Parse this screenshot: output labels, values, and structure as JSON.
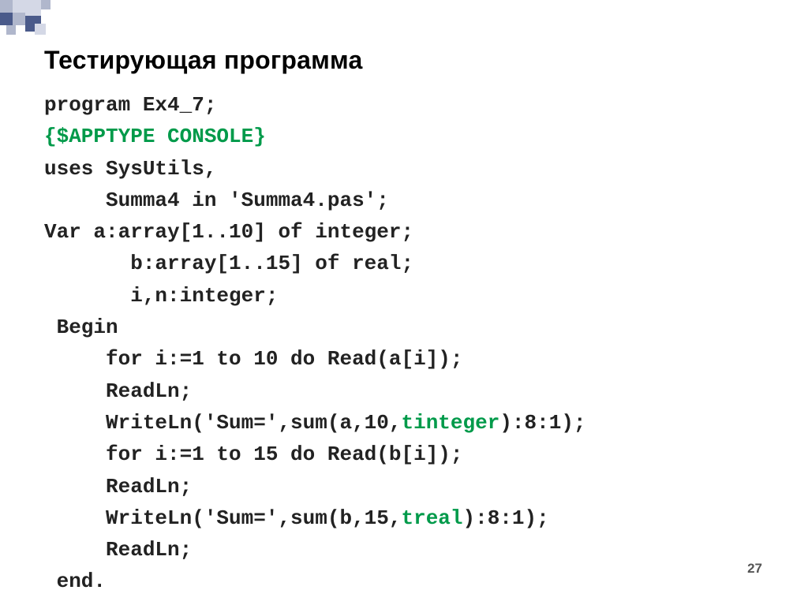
{
  "title": "Тестирующая программа",
  "code": {
    "l1": "program Ex4_7;",
    "l2": "{$APPTYPE CONSOLE}",
    "l3": "uses SysUtils,",
    "l4": "     Summa4 in 'Summa4.pas';",
    "l5": "Var a:array[1..10] of integer;",
    "l6": "       b:array[1..15] of real;",
    "l7": "       i,n:integer;",
    "l8": " Begin",
    "l9": "     for i:=1 to 10 do Read(a[i]);",
    "l10": "     ReadLn;",
    "l11a": "     WriteLn('Sum=',sum(a,10,",
    "l11b": "tinteger",
    "l11c": "):8:1);",
    "l12": "     for i:=1 to 15 do Read(b[i]);",
    "l13": "     ReadLn;",
    "l14a": "     WriteLn('Sum=',sum(b,15,",
    "l14b": "treal",
    "l14c": "):8:1);",
    "l15": "     ReadLn;",
    "l16": " end."
  },
  "page_number": "27"
}
